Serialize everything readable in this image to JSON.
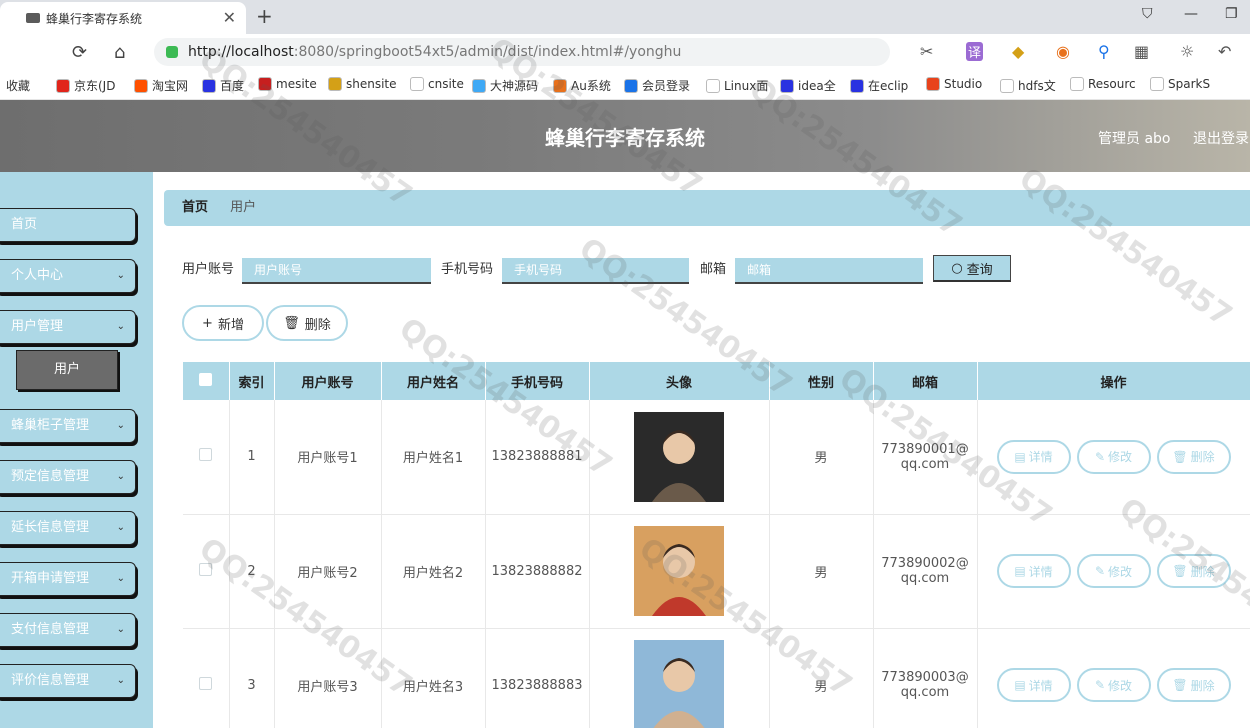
{
  "browser": {
    "tab_title": "蜂巢行李寄存系统",
    "url_host": "http://localhost",
    "url_rest": ":8080/springboot54xt5/admin/dist/index.html#/yonghu",
    "bookmarks": [
      "收藏",
      "京东(JD",
      "淘宝网",
      "百度",
      "mesite",
      "shensite",
      "cnsite",
      "大神源码",
      "Au系统",
      "会员登录",
      "Linux面",
      "idea全",
      "在eclip",
      "Studio",
      "hdfs文",
      "Resourc",
      "SparkS"
    ],
    "bookmark_colors": [
      "#ffffff",
      "#e1251b",
      "#ff5000",
      "#2932e1",
      "#c71f1f",
      "#d4a017",
      "#ffffff",
      "#3fa9f5",
      "#e8711c",
      "#1a73e8",
      "#ffffff",
      "#2932e1",
      "#2932e1",
      "#e8431c",
      "#ffffff",
      "#ffffff",
      "#ffffff"
    ]
  },
  "header": {
    "title": "蜂巢行李寄存系统",
    "admin": "管理员 abo",
    "logout": "退出登录"
  },
  "sidebar": {
    "items": [
      {
        "label": "首页",
        "chev": ""
      },
      {
        "label": "个人中心",
        "chev": "⌄"
      },
      {
        "label": "用户管理",
        "chev": "⌄"
      },
      {
        "label": "蜂巢柜子管理",
        "chev": "⌄"
      },
      {
        "label": "预定信息管理",
        "chev": "⌄"
      },
      {
        "label": "延长信息管理",
        "chev": "⌄"
      },
      {
        "label": "开箱申请管理",
        "chev": "⌄"
      },
      {
        "label": "支付信息管理",
        "chev": "⌄"
      },
      {
        "label": "评价信息管理",
        "chev": "⌄"
      }
    ],
    "sub_item": "用户"
  },
  "breadcrumb": {
    "home": "首页",
    "current": "用户"
  },
  "search": {
    "account_label": "用户账号",
    "account_placeholder": "用户账号",
    "phone_label": "手机号码",
    "phone_placeholder": "手机号码",
    "email_label": "邮箱",
    "email_placeholder": "邮箱",
    "query_button": "查询"
  },
  "actions": {
    "add": "新增",
    "delete": "删除"
  },
  "table": {
    "headers": [
      "",
      "索引",
      "用户账号",
      "用户姓名",
      "手机号码",
      "头像",
      "性别",
      "邮箱",
      "操作"
    ],
    "rows": [
      {
        "index": "1",
        "account": "用户账号1",
        "name": "用户姓名1",
        "phone": "13823888881",
        "gender": "男",
        "email_a": "773890001@",
        "email_b": "qq.com"
      },
      {
        "index": "2",
        "account": "用户账号2",
        "name": "用户姓名2",
        "phone": "13823888882",
        "gender": "男",
        "email_a": "773890002@",
        "email_b": "qq.com"
      },
      {
        "index": "3",
        "account": "用户账号3",
        "name": "用户姓名3",
        "phone": "13823888883",
        "gender": "男",
        "email_a": "773890003@",
        "email_b": "qq.com"
      }
    ],
    "ops": {
      "detail": "详情",
      "edit": "修改",
      "remove": "删除"
    }
  },
  "colors": {
    "accent": "#add8e6",
    "header_bg": "#7b7b7b",
    "active_sub": "#6b6b6b"
  }
}
